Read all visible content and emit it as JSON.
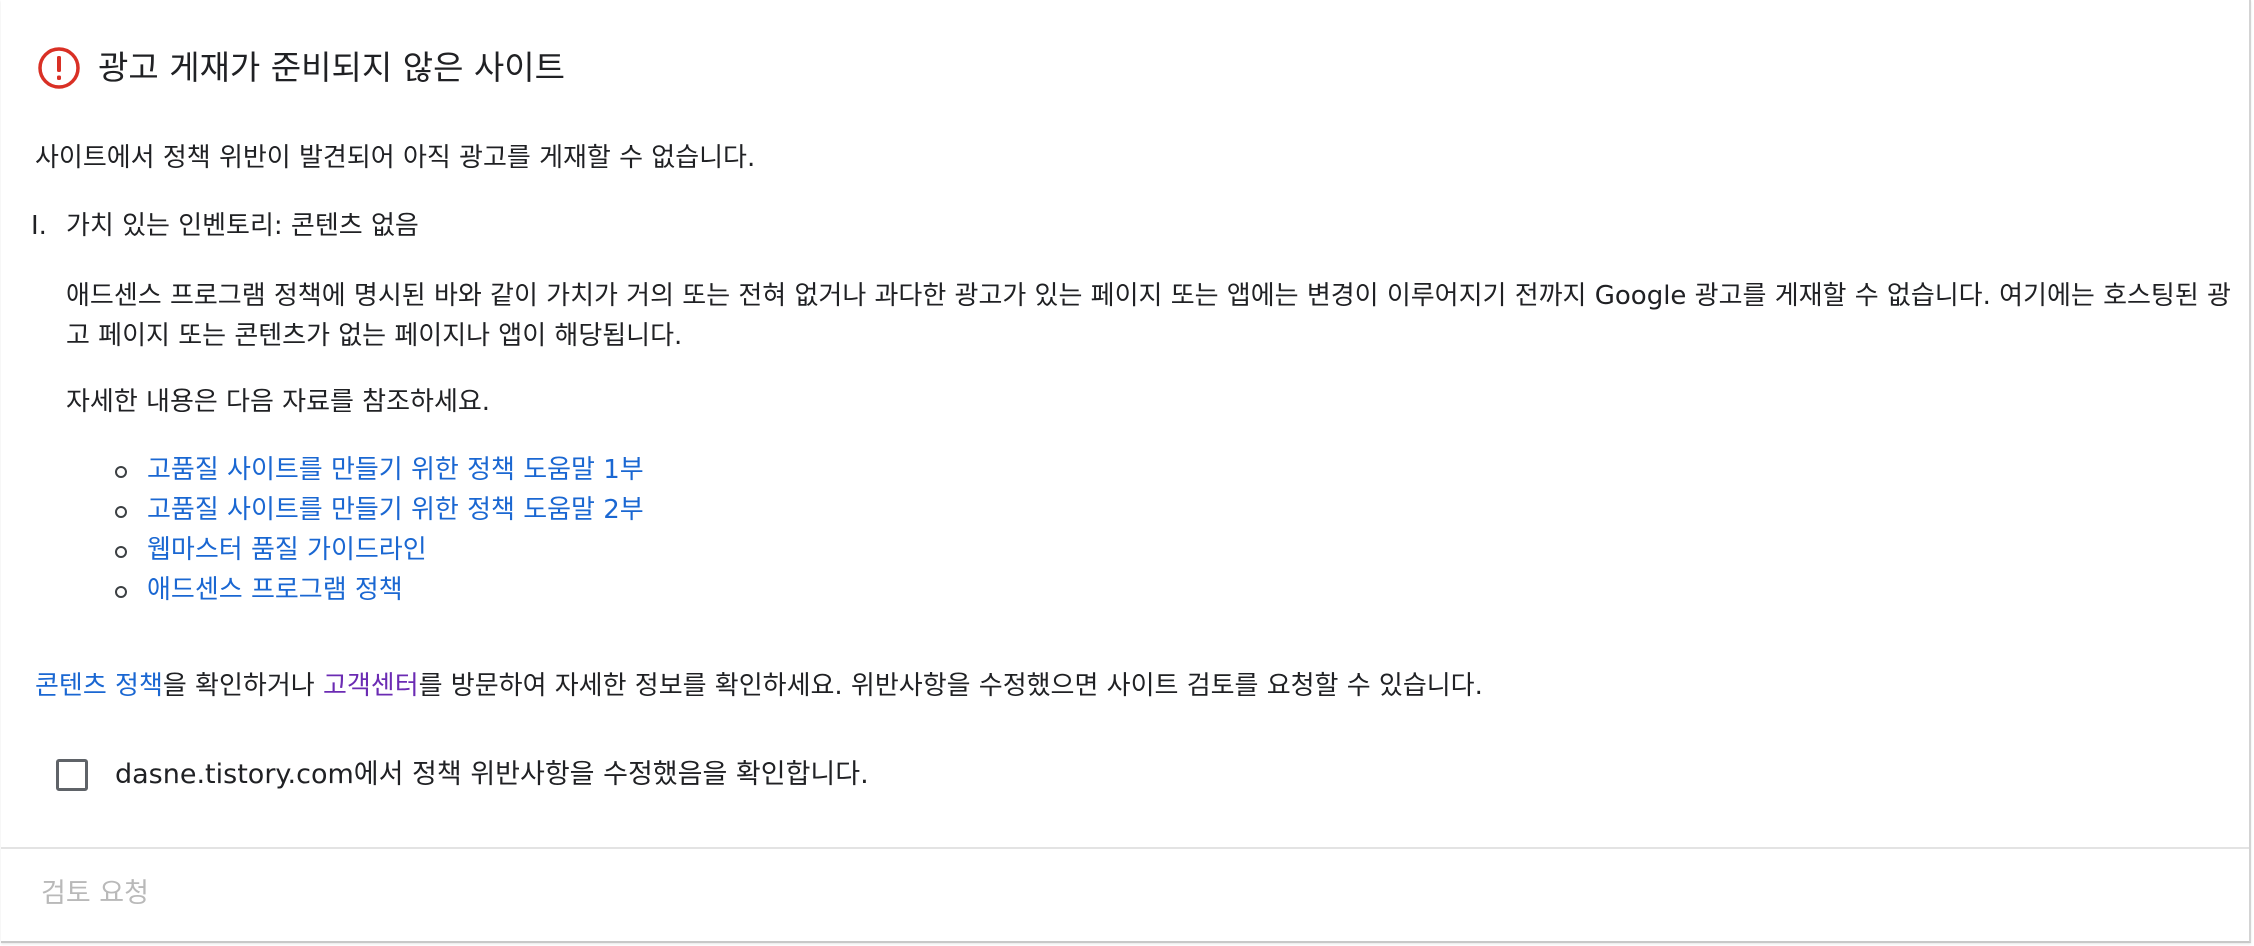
{
  "header": {
    "icon": "alert-circle-icon",
    "icon_color": "#d93025",
    "title": "광고 게재가 준비되지 않은 사이트"
  },
  "summary": "사이트에서 정책 위반이 발견되어 아직 광고를 게재할 수 없습니다.",
  "violation": {
    "number": "I.",
    "title": "가치 있는 인벤토리: 콘텐츠 없음",
    "description": "애드센스 프로그램 정책에 명시된 바와 같이 가치가 거의 또는 전혀 없거나 과다한 광고가 있는 페이지 또는 앱에는 변경이 이루어지기 전까지 Google 광고를 게재할 수 없습니다. 여기에는 호스팅된 광고 페이지 또는 콘텐츠가 없는 페이지나 앱이 해당됩니다.",
    "more_info": "자세한 내용은 다음 자료를 참조하세요.",
    "links": [
      {
        "label": "고품질 사이트를 만들기 위한 정책 도움말 1부"
      },
      {
        "label": "고품질 사이트를 만들기 위한 정책 도움말 2부"
      },
      {
        "label": "웹마스터 품질 가이드라인"
      },
      {
        "label": "애드센스 프로그램 정책"
      }
    ]
  },
  "footer_note": {
    "link1": "콘텐츠 정책",
    "text1": "을 확인하거나 ",
    "link2": "고객센터",
    "text2": "를 방문하여 자세한 정보를 확인하세요. 위반사항을 수정했으면 사이트 검토를 요청할 수 있습니다."
  },
  "confirm": {
    "checked": false,
    "label": "dasne.tistory.com에서 정책 위반사항을 수정했음을 확인합니다."
  },
  "actions": {
    "review_button": "검토 요청",
    "review_enabled": false
  },
  "colors": {
    "link": "#1a67d2",
    "visited_link": "#6b2bb3",
    "disabled_text": "#b9b9b9"
  }
}
